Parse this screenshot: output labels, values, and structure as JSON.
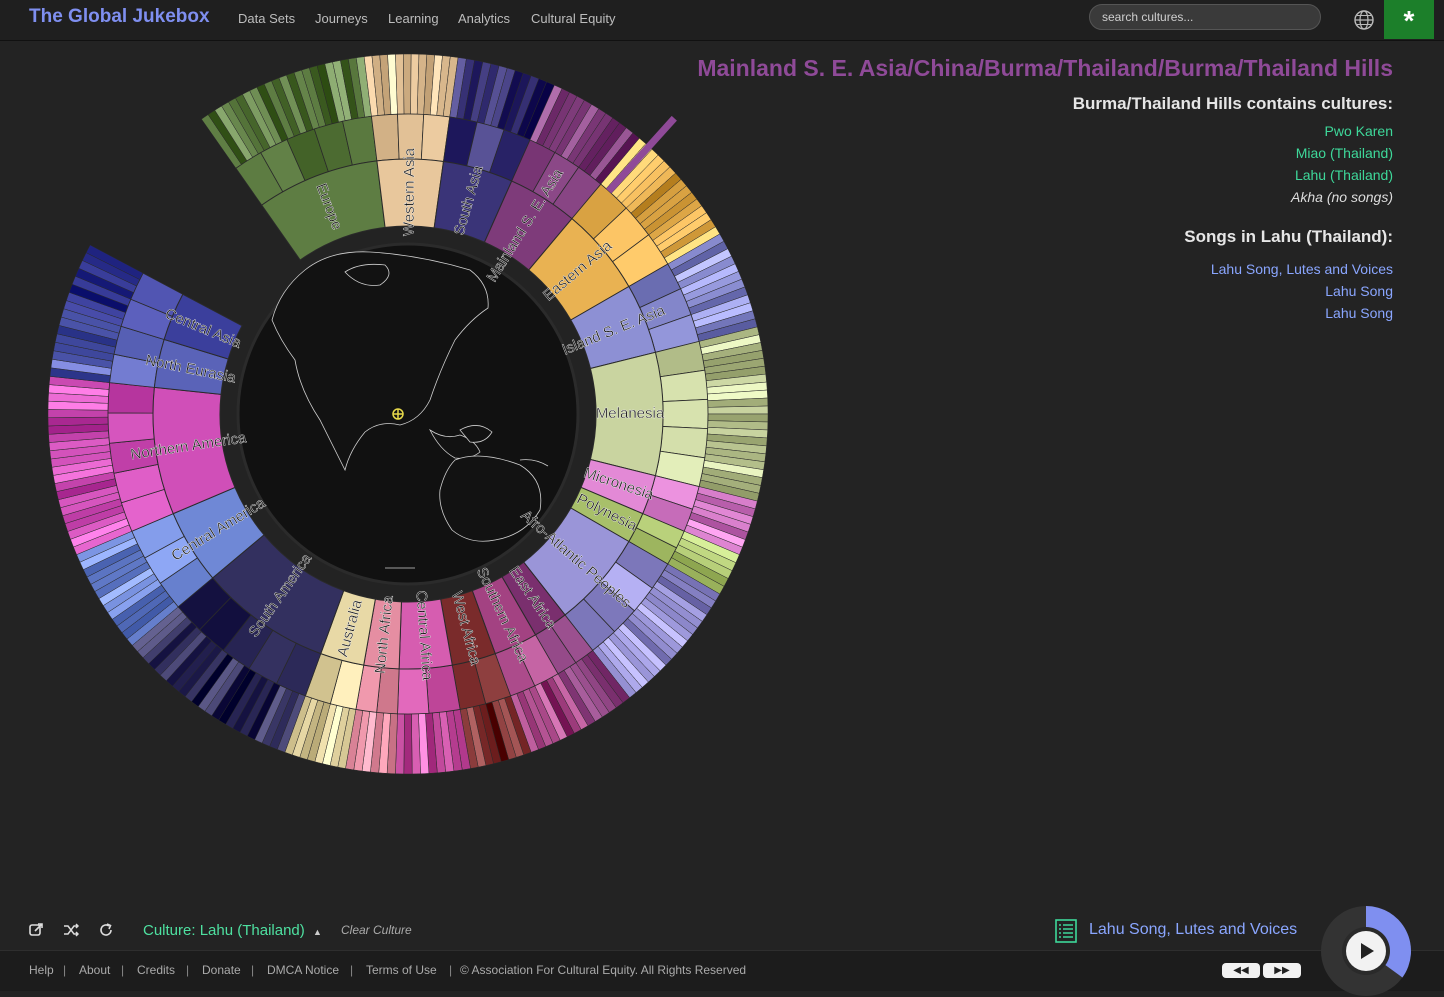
{
  "header": {
    "brand": "The Global Jukebox",
    "nav": [
      "Data Sets",
      "Journeys",
      "Learning",
      "Analytics",
      "Cultural Equity"
    ],
    "search_placeholder": "search cultures...",
    "star_symbol": "*"
  },
  "wheel": {
    "regions": [
      {
        "label": "Europe",
        "color": "#5e7d43"
      },
      {
        "label": "Western Asia",
        "color": "#e8c79c"
      },
      {
        "label": "South Asia",
        "color": "#3a3478"
      },
      {
        "label": "Mainland S. E. Asia",
        "color": "#7e3b7a"
      },
      {
        "label": "Eastern Asia",
        "color": "#e9b252"
      },
      {
        "label": "Island S. E. Asia",
        "color": "#8d90d4"
      },
      {
        "label": "Melanesia",
        "color": "#c9d4a0"
      },
      {
        "label": "Micronesia",
        "color": "#e389d6"
      },
      {
        "label": "Polynesia",
        "color": "#a8c06a"
      },
      {
        "label": "Afro-Atlantic Peoples",
        "color": "#9a95d8"
      },
      {
        "label": "East Africa",
        "color": "#7a2f6e"
      },
      {
        "label": "Southern Africa",
        "color": "#a34282"
      },
      {
        "label": "West Africa",
        "color": "#7a2b2b"
      },
      {
        "label": "Central Africa",
        "color": "#d65db0"
      },
      {
        "label": "North Africa",
        "color": "#e58ea2"
      },
      {
        "label": "Australia",
        "color": "#e8d9a6"
      },
      {
        "label": "South America",
        "color": "#33305f"
      },
      {
        "label": "Central America",
        "color": "#6f88d6"
      },
      {
        "label": "Northern America",
        "color": "#d04fb8"
      },
      {
        "label": "North Eurasia",
        "color": "#5a63b8"
      },
      {
        "label": "Central Asia",
        "color": "#3b3f9c"
      }
    ]
  },
  "info": {
    "breadcrumb": "Mainland S. E. Asia/China/Burma/Thailand/Burma/Thailand Hills",
    "contains_title": "Burma/Thailand Hills contains cultures:",
    "cultures": [
      "Pwo Karen",
      "Miao (Thailand)",
      "Lahu (Thailand)"
    ],
    "no_songs_culture": "Akha (no songs)",
    "songs_title": "Songs in Lahu (Thailand):",
    "songs": [
      "Lahu Song, Lutes and Voices",
      "Lahu Song",
      "Lahu Song"
    ]
  },
  "controls": {
    "culture_label": "Culture: Lahu (Thailand)",
    "clear_label": "Clear Culture",
    "now_playing": "Lahu Song, Lutes and Voices",
    "play_progress": 0.35
  },
  "footer": {
    "links": [
      "Help",
      "About",
      "Credits",
      "Donate",
      "DMCA Notice",
      "Terms of Use"
    ],
    "copyright": "© Association For Cultural Equity. All Rights Reserved",
    "rewind_label": "◀◀",
    "forward_label": "▶▶"
  },
  "colors": {
    "brand": "#7f8ff0",
    "breadcrumb": "#8f4a98",
    "culture_link": "#3ed89a",
    "song_link": "#8aa6ff",
    "star_bg": "#1c7f2a"
  }
}
